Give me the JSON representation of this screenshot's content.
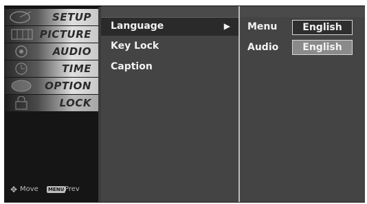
{
  "sidebar": {
    "items": [
      {
        "label": "SETUP",
        "icon": "satellite-dish-icon"
      },
      {
        "label": "PICTURE",
        "icon": "film-strip-icon"
      },
      {
        "label": "AUDIO",
        "icon": "speaker-icon"
      },
      {
        "label": "TIME",
        "icon": "clock-icon"
      },
      {
        "label": "OPTION",
        "icon": "option-tag-icon"
      },
      {
        "label": "LOCK",
        "icon": "padlock-icon"
      }
    ],
    "active_item": "LOCK",
    "footer": {
      "move_label": "Move",
      "menu_key": "MENU",
      "prev_label": "Prev",
      "move_icon": "dpad-icon"
    }
  },
  "menu": {
    "items": [
      {
        "label": "Language",
        "has_submenu": true
      },
      {
        "label": "Key Lock"
      },
      {
        "label": "Caption"
      }
    ],
    "arrow_glyph": "▶"
  },
  "submenu": {
    "rows": [
      {
        "label": "Menu",
        "value": "English"
      },
      {
        "label": "Audio",
        "value": "English"
      }
    ]
  }
}
